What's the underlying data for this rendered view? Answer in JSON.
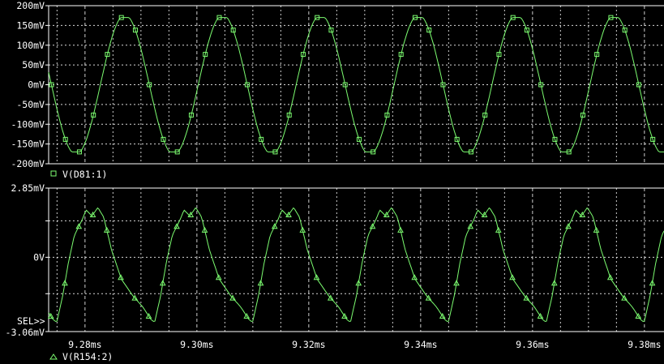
{
  "window": {
    "background": "#000000",
    "trace_color": "#7CFC70",
    "axis_color": "#ffffff"
  },
  "chart_data": [
    {
      "type": "line",
      "series": [
        {
          "name": "V(D81:1)",
          "marker": "square"
        }
      ],
      "y_tick_labels": [
        "200mV",
        "150mV",
        "100mV",
        "50mV",
        "0mV",
        "-50mV",
        "-100mV",
        "-150mV",
        "-200mV"
      ],
      "y_tick_values": [
        200,
        150,
        100,
        50,
        0,
        -50,
        -100,
        -150,
        -200
      ],
      "ylim": [
        -200,
        200
      ],
      "y_unit": "mV",
      "xlim": [
        9.2735,
        9.3835
      ],
      "waveform": {
        "shape": "sine",
        "amplitude": 170,
        "period_ms": 0.0175,
        "phase_ms": 9.28275,
        "cycles_visible": 6
      },
      "grid": true
    },
    {
      "type": "line",
      "series": [
        {
          "name": "V(R154:2)",
          "marker": "triangle"
        }
      ],
      "y_tick_labels": [
        "2.85mV",
        "0V",
        "-3.06mV"
      ],
      "y_tick_values": [
        2.85,
        0,
        -3.06
      ],
      "ylim": [
        -3.06,
        2.85
      ],
      "y_unit": "mV",
      "xlim": [
        9.2735,
        9.3835
      ],
      "waveform": {
        "shape": "distorted-periodic",
        "max": 2.05,
        "min": -2.7,
        "period_ms": 0.0175,
        "cycles_visible": 6
      },
      "grid": true,
      "selected_label": "SEL>>"
    }
  ],
  "x_axis": {
    "tick_labels": [
      "9.28ms",
      "9.30ms",
      "9.32ms",
      "9.34ms",
      "9.36ms",
      "9.38ms"
    ],
    "tick_values": [
      9.28,
      9.3,
      9.32,
      9.34,
      9.36,
      9.38
    ],
    "unit": "ms"
  }
}
